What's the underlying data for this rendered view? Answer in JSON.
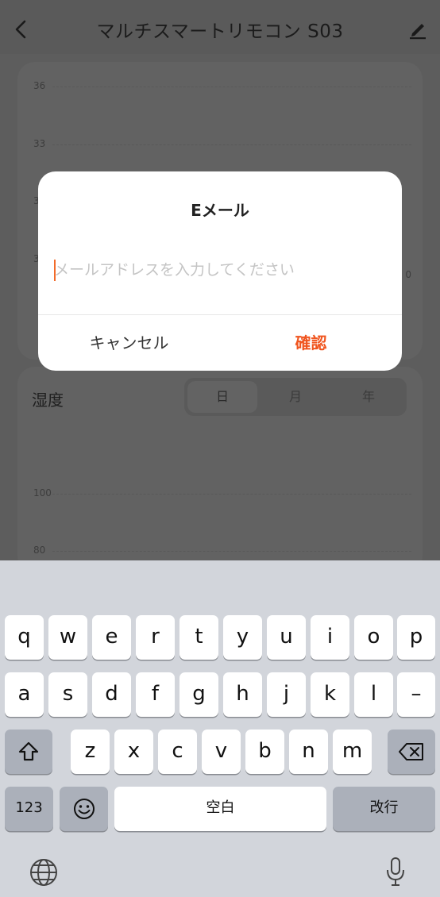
{
  "nav": {
    "title": "マルチスマートリモコン S03",
    "back_icon": "chevron-left-icon",
    "edit_icon": "pencil-icon"
  },
  "temp_chart": {
    "ticks": [
      "36",
      "33",
      "3",
      "3"
    ],
    "right_tick": "0"
  },
  "humidity": {
    "title": "湿度",
    "tabs": [
      "日",
      "月",
      "年"
    ],
    "active_tab": "日",
    "ticks": [
      "100",
      "80"
    ]
  },
  "dialog": {
    "title": "Eメール",
    "placeholder": "メールアドレスを入力してください",
    "value": "",
    "cancel_label": "キャンセル",
    "confirm_label": "確認",
    "confirm_color": "#f0551f"
  },
  "keyboard": {
    "row1": [
      "q",
      "w",
      "e",
      "r",
      "t",
      "y",
      "u",
      "i",
      "o",
      "p"
    ],
    "row2": [
      "a",
      "s",
      "d",
      "f",
      "g",
      "h",
      "j",
      "k",
      "l",
      "–"
    ],
    "row3": [
      "z",
      "x",
      "c",
      "v",
      "b",
      "n",
      "m"
    ],
    "numbers_label": "123",
    "space_label": "空白",
    "return_label": "改行",
    "shift_icon": "shift-icon",
    "delete_icon": "backspace-icon",
    "emoji_icon": "emoji-icon",
    "globe_icon": "globe-icon",
    "mic_icon": "microphone-icon"
  }
}
